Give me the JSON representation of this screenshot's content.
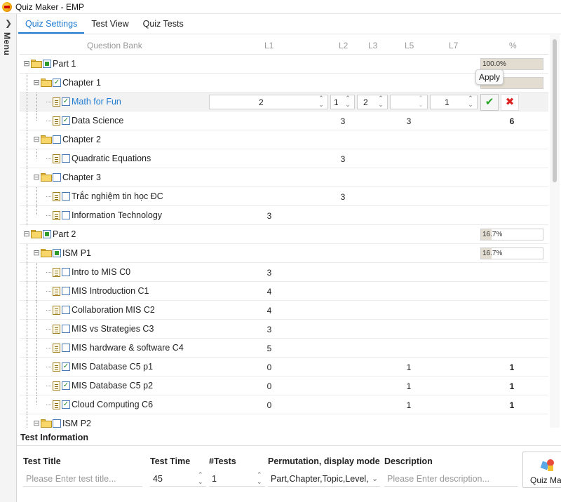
{
  "window": {
    "title": "Quiz Maker - EMP"
  },
  "sidemenu": {
    "label": "Menu"
  },
  "tabs": [
    {
      "label": "Quiz Settings",
      "active": true
    },
    {
      "label": "Test View",
      "active": false
    },
    {
      "label": "Quiz Tests",
      "active": false
    }
  ],
  "grid": {
    "headers": {
      "bank": "Question Bank",
      "l1": "L1",
      "l2": "L2",
      "l3": "L3",
      "l5": "L5",
      "l7": "L7",
      "pct": "%"
    },
    "rows": [
      {
        "label": "Part 1",
        "pct_text": "100.0%",
        "pct_value": 1.0
      },
      {
        "label": "Chapter 1"
      },
      {
        "label": "Math for Fun",
        "edit": {
          "l1": "2",
          "l2": "1",
          "l3": "2",
          "l5": "",
          "l7": "1"
        }
      },
      {
        "label": "Data Science",
        "l2": "3",
        "l5": "3",
        "total": "6"
      },
      {
        "label": "Chapter 2"
      },
      {
        "label": "Quadratic Equations",
        "l2": "3"
      },
      {
        "label": "Chapter 3"
      },
      {
        "label": "Trắc nghiệm tin học ĐC",
        "l2": "3"
      },
      {
        "label": "Information Technology",
        "l1": "3"
      },
      {
        "label": "Part 2",
        "pct_text": "16.7%",
        "pct_value": 0.167
      },
      {
        "label": "ISM P1",
        "pct_text": "16.7%",
        "pct_value": 0.167
      },
      {
        "label": "Intro to MIS C0",
        "l1": "3"
      },
      {
        "label": "MIS Introduction C1",
        "l1": "4"
      },
      {
        "label": "Collaboration MIS C2",
        "l1": "4"
      },
      {
        "label": "MIS vs Strategies C3",
        "l1": "3"
      },
      {
        "label": "MIS hardware & software C4",
        "l1": "5"
      },
      {
        "label": "MIS Database C5 p1",
        "l1": "0",
        "l5": "1",
        "total": "1"
      },
      {
        "label": "MIS Database C5 p2",
        "l1": "0",
        "l5": "1",
        "total": "1"
      },
      {
        "label": "Cloud Computing C6",
        "l1": "0",
        "l5": "1",
        "total": "1"
      },
      {
        "label": "ISM P2"
      }
    ],
    "tooltip": "Apply"
  },
  "test_info": {
    "title": "Test Information",
    "fields": {
      "test_title_label": "Test Title",
      "test_title_placeholder": "Please Enter test title...",
      "test_time_label": "Test Time",
      "test_time_value": "45",
      "tests_label": "#Tests",
      "tests_value": "1",
      "perm_label": "Permutation, display mode",
      "perm_value": "Part,Chapter,Topic,Level,C",
      "desc_label": "Description",
      "desc_placeholder": "Please Enter description..."
    },
    "quiz_button": "Quiz Ma"
  }
}
